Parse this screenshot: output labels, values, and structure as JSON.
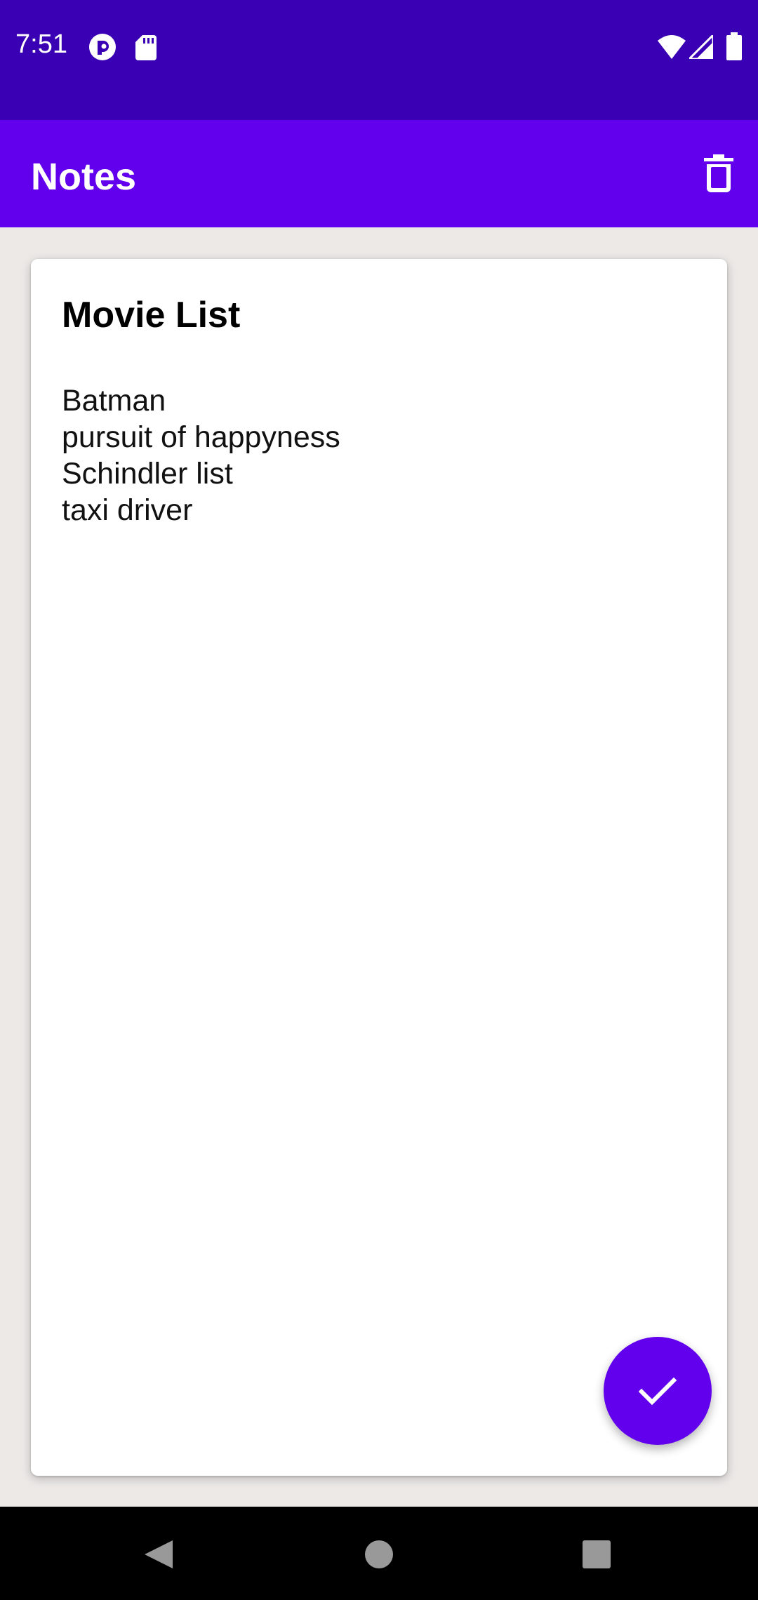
{
  "status_bar": {
    "time": "7:51",
    "background": "#3a00b4",
    "left_icons": [
      "notification-app-icon",
      "sd-card-icon"
    ],
    "right_icons": [
      "wifi-icon",
      "cellular-signal-icon",
      "battery-icon"
    ]
  },
  "app_bar": {
    "title": "Notes",
    "background": "#6200ee",
    "action_icon": "delete-icon"
  },
  "note": {
    "title": "Movie List",
    "lines": [
      "Batman",
      "pursuit of happyness",
      "Schindler list",
      "taxi driver"
    ]
  },
  "fab": {
    "icon": "check-icon",
    "color": "#6200ee"
  },
  "nav_bar": {
    "buttons": [
      "back-icon",
      "home-icon",
      "recents-icon"
    ]
  }
}
